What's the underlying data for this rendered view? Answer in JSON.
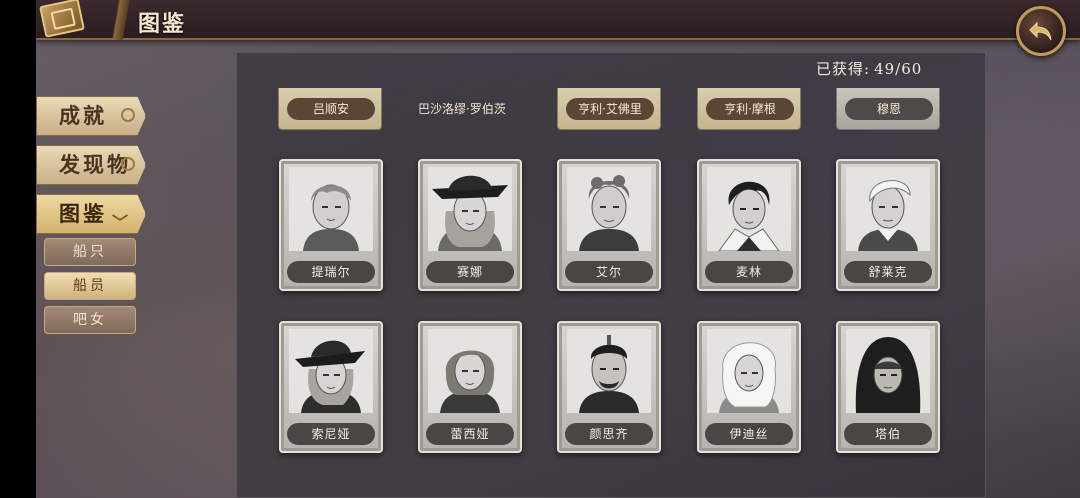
{
  "header": {
    "title": "图鉴"
  },
  "counter": {
    "label": "已获得:",
    "value": "49/60"
  },
  "sidebar": {
    "tabs": [
      {
        "label": "成就"
      },
      {
        "label": "发现物"
      },
      {
        "label": "图鉴"
      }
    ],
    "subtabs": [
      {
        "label": "船只"
      },
      {
        "label": "船员"
      },
      {
        "label": "吧女"
      }
    ]
  },
  "top_row": [
    {
      "name": "吕顺安"
    },
    {
      "name": "巴沙洛缪·罗伯茨"
    },
    {
      "name": "亨利·艾佛里"
    },
    {
      "name": "亨利·摩根"
    },
    {
      "name": "穆恩"
    }
  ],
  "crew": [
    {
      "name": "提瑞尔",
      "icon": "young-man-portrait-icon"
    },
    {
      "name": "赛娜",
      "icon": "pirate-woman-hat-portrait-icon"
    },
    {
      "name": "艾尔",
      "icon": "curly-hair-man-portrait-icon"
    },
    {
      "name": "麦林",
      "icon": "dark-hair-youth-portrait-icon"
    },
    {
      "name": "舒莱克",
      "icon": "slick-hair-man-portrait-icon"
    },
    {
      "name": "索尼娅",
      "icon": "woman-hat-portrait-icon"
    },
    {
      "name": "蕾西娅",
      "icon": "woman-bob-hair-portrait-icon"
    },
    {
      "name": "颜思齐",
      "icon": "bearded-man-portrait-icon"
    },
    {
      "name": "伊迪丝",
      "icon": "white-hair-woman-portrait-icon"
    },
    {
      "name": "塔伯",
      "icon": "hooded-figure-portrait-icon"
    }
  ],
  "colors": {
    "accent_gold": "#c49a5a",
    "panel": "#36323a",
    "name_plate": "#4a4646"
  }
}
